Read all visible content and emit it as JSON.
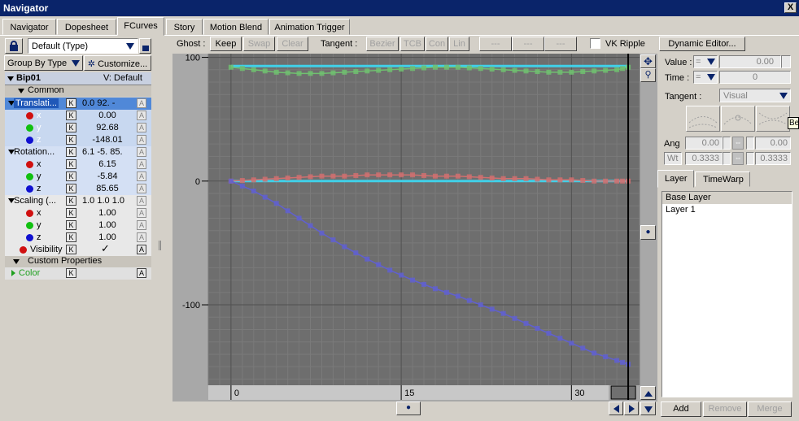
{
  "window": {
    "title": "Navigator",
    "close": "X"
  },
  "tabs": [
    "Navigator",
    "Dopesheet",
    "FCurves",
    "Story",
    "Motion Blend",
    "Animation Trigger"
  ],
  "selected_tab": "FCurves",
  "left": {
    "filter_value": "Default (Type)",
    "group_by": "Group By Type",
    "customize": "Customize...",
    "object": {
      "name": "Bip01",
      "v_label": "V: Default"
    },
    "section_common": "Common",
    "rows": [
      {
        "label": "Translati...",
        "val": "0.0 92.  -",
        "kind": "group"
      },
      {
        "label": "x",
        "val": "0.00",
        "kind": "x"
      },
      {
        "label": "y",
        "val": "92.68",
        "kind": "y"
      },
      {
        "label": "z",
        "val": "-148.01",
        "kind": "z"
      },
      {
        "label": "Rotation...",
        "val": "6.1  -5.  85.",
        "kind": "group"
      },
      {
        "label": "x",
        "val": "6.15",
        "kind": "x"
      },
      {
        "label": "y",
        "val": "-5.84",
        "kind": "y"
      },
      {
        "label": "z",
        "val": "85.65",
        "kind": "z"
      },
      {
        "label": "Scaling (...",
        "val": "1.0 1.0 1.0",
        "kind": "group"
      },
      {
        "label": "x",
        "val": "1.00",
        "kind": "x"
      },
      {
        "label": "y",
        "val": "1.00",
        "kind": "y"
      },
      {
        "label": "z",
        "val": "1.00",
        "kind": "z"
      },
      {
        "label": "Visibility",
        "val": "",
        "kind": "vis"
      }
    ],
    "section_custom": "Custom Properties",
    "color_label": "Color",
    "k": "K",
    "a": "A"
  },
  "toolbar": {
    "ghost": "Ghost :",
    "keep": "Keep",
    "swap": "Swap",
    "clear": "Clear",
    "tangent": "Tangent :",
    "bezier": "Bezier",
    "tcb": "TCB",
    "con": "Con",
    "lin": "Lin",
    "dash1": "---",
    "dash2": "---",
    "dash3": "---",
    "vk_ripple": "VK Ripple",
    "dynamic_editor": "Dynamic Editor..."
  },
  "graph": {
    "y_labels": [
      "100",
      "0",
      "-100"
    ],
    "x_labels": [
      "0",
      "15",
      "30"
    ],
    "colors": {
      "cyan": "#40d0e8",
      "green": "#70c070",
      "red": "#d07070",
      "purple": "#6060d0"
    }
  },
  "chart_data": {
    "type": "line",
    "xlim": [
      -2,
      36
    ],
    "ylim": [
      -165,
      103
    ],
    "series": [
      {
        "color": "#40d0e8",
        "x": [
          0,
          35
        ],
        "y": [
          93,
          93
        ]
      },
      {
        "color": "#70c070",
        "x": [
          0,
          2,
          4,
          6,
          8,
          10,
          12,
          14,
          16,
          18,
          20,
          22,
          24,
          26,
          28,
          30,
          32,
          34,
          35
        ],
        "y": [
          92,
          90,
          88,
          87,
          87,
          88,
          89,
          90,
          91,
          92,
          92,
          91,
          90,
          89,
          88,
          88,
          89,
          90,
          92
        ]
      },
      {
        "color": "#40d0e8",
        "x": [
          0,
          35
        ],
        "y": [
          0,
          0
        ]
      },
      {
        "color": "#d07070",
        "x": [
          0,
          2,
          4,
          6,
          8,
          10,
          12,
          14,
          16,
          18,
          20,
          22,
          24,
          26,
          28,
          30,
          32,
          34,
          35
        ],
        "y": [
          0,
          1,
          2,
          3,
          4,
          4,
          5,
          5,
          5,
          4,
          4,
          3,
          2,
          2,
          1,
          1,
          0,
          0,
          0
        ]
      },
      {
        "color": "#6060d0",
        "x": [
          0,
          2,
          4,
          6,
          8,
          10,
          12,
          14,
          16,
          18,
          20,
          22,
          24,
          26,
          28,
          30,
          32,
          34,
          35
        ],
        "y": [
          0,
          -8,
          -18,
          -30,
          -42,
          -53,
          -63,
          -72,
          -80,
          -87,
          -93,
          -100,
          -107,
          -115,
          -123,
          -131,
          -139,
          -145,
          -148
        ]
      }
    ]
  },
  "right": {
    "value_label": "Value :",
    "value": "0.00",
    "time_label": "Time :",
    "time": "0",
    "tangent_label": "Tangent :",
    "tangent_value": "Visual",
    "ang_label": "Ang",
    "ang_left": "0.00",
    "ang_right": "0.00",
    "wt_label": "Wt",
    "wt_left": "0.3333",
    "wt_right": "0.3333",
    "tooltip": "Be",
    "tab_layer": "Layer",
    "tab_timewarp": "TimeWarp",
    "layers": [
      "Base Layer",
      "Layer 1"
    ],
    "add": "Add",
    "remove": "Remove",
    "merge": "Merge"
  }
}
